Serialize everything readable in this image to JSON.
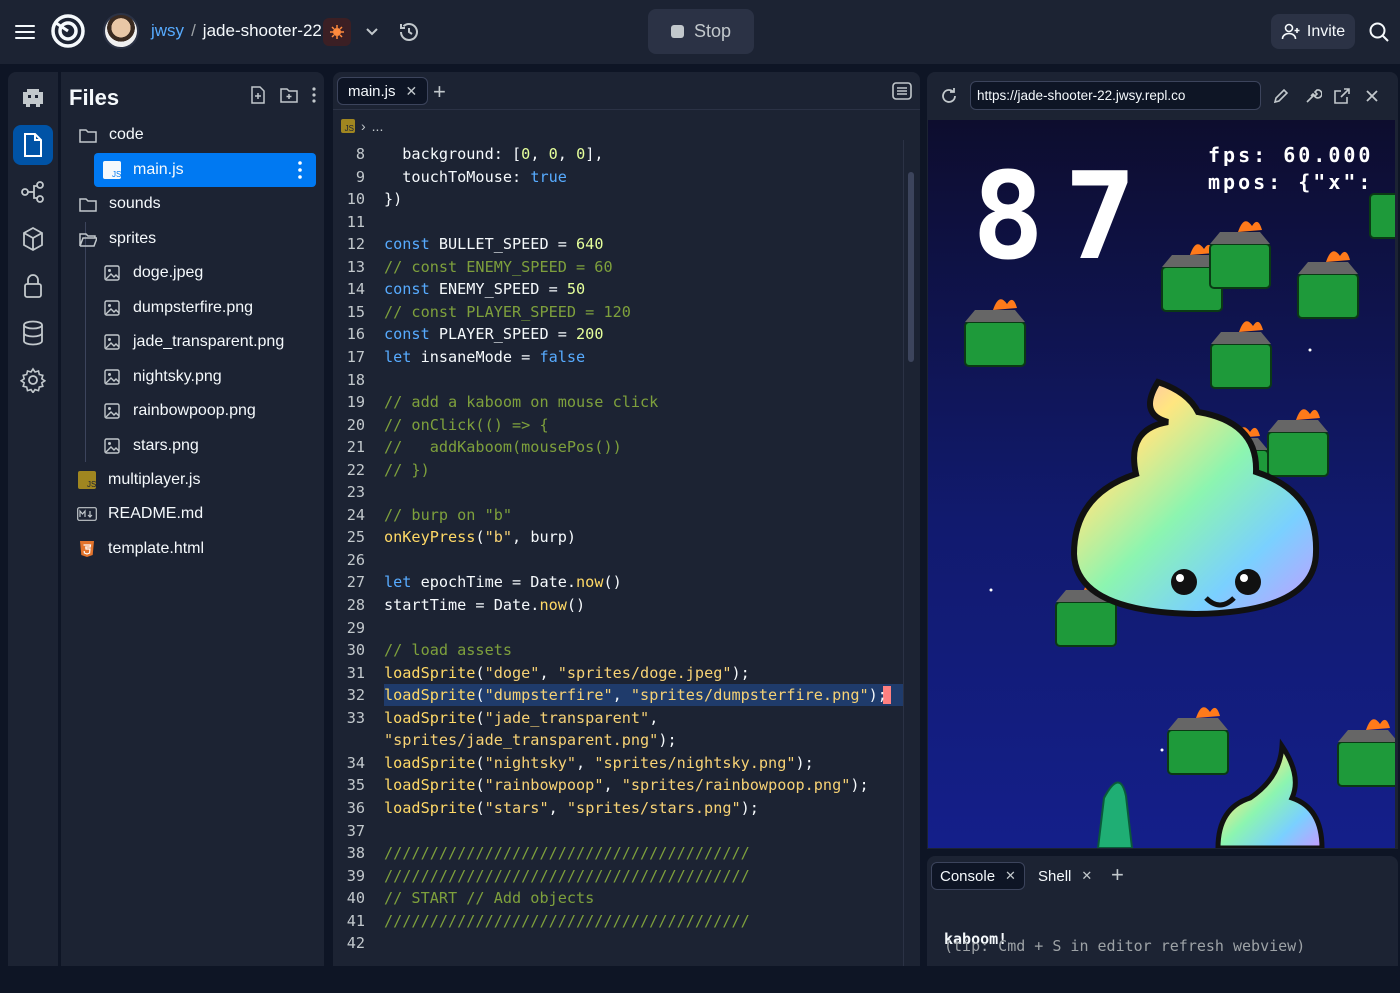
{
  "topbar": {
    "user": "jwsy",
    "separator": "/",
    "project": "jade-shooter-22",
    "stop_label": "Stop",
    "invite_label": "Invite"
  },
  "files": {
    "title": "Files",
    "items": [
      {
        "label": "code",
        "icon": "folder-icon"
      },
      {
        "label": "main.js",
        "icon": "js-file-icon"
      },
      {
        "label": "sounds",
        "icon": "folder-icon"
      },
      {
        "label": "sprites",
        "icon": "folder-open-icon"
      },
      {
        "label": "doge.jpeg",
        "icon": "image-file-icon"
      },
      {
        "label": "dumpsterfire.png",
        "icon": "image-file-icon"
      },
      {
        "label": "jade_transparent.png",
        "icon": "image-file-icon"
      },
      {
        "label": "nightsky.png",
        "icon": "image-file-icon"
      },
      {
        "label": "rainbowpoop.png",
        "icon": "image-file-icon"
      },
      {
        "label": "stars.png",
        "icon": "image-file-icon"
      },
      {
        "label": "multiplayer.js",
        "icon": "js-file-icon"
      },
      {
        "label": "README.md",
        "icon": "markdown-file-icon"
      },
      {
        "label": "template.html",
        "icon": "html-file-icon"
      }
    ]
  },
  "editor": {
    "tab_label": "main.js",
    "path_ellipsis": "...",
    "js_badge": "JS",
    "lines": [
      {
        "n": "8",
        "html": "  background: [<span class=\"num\">0</span>, <span class=\"num\">0</span>, <span class=\"num\">0</span>],"
      },
      {
        "n": "9",
        "html": "  touchToMouse: <span class=\"kw\">true</span>"
      },
      {
        "n": "10",
        "html": "})"
      },
      {
        "n": "11",
        "html": ""
      },
      {
        "n": "12",
        "html": "<span class=\"kw\">const</span> BULLET_SPEED = <span class=\"num\">640</span>"
      },
      {
        "n": "13",
        "html": "<span class=\"cm\">// const ENEMY_SPEED = 60</span>"
      },
      {
        "n": "14",
        "html": "<span class=\"kw\">const</span> ENEMY_SPEED = <span class=\"num\">50</span>"
      },
      {
        "n": "15",
        "html": "<span class=\"cm\">// const PLAYER_SPEED = 120</span>"
      },
      {
        "n": "16",
        "html": "<span class=\"kw\">const</span> PLAYER_SPEED = <span class=\"num\">200</span>"
      },
      {
        "n": "17",
        "html": "<span class=\"kw\">let</span> insaneMode = <span class=\"kw\">false</span>"
      },
      {
        "n": "18",
        "html": ""
      },
      {
        "n": "19",
        "html": "<span class=\"cm\">// add a kaboom on mouse click</span>"
      },
      {
        "n": "20",
        "html": "<span class=\"cm\">// onClick(() =&gt; {</span>"
      },
      {
        "n": "21",
        "html": "<span class=\"cm\">//   addKaboom(mousePos())</span>"
      },
      {
        "n": "22",
        "html": "<span class=\"cm\">// })</span>"
      },
      {
        "n": "23",
        "html": ""
      },
      {
        "n": "24",
        "html": "<span class=\"cm\">// burp on \"b\"</span>"
      },
      {
        "n": "25",
        "html": "<span class=\"fn\">onKeyPress</span>(<span class=\"str\">\"b\"</span>, burp)"
      },
      {
        "n": "26",
        "html": ""
      },
      {
        "n": "27",
        "html": "<span class=\"kw\">let</span> epochTime = Date.<span class=\"fn\">now</span>()"
      },
      {
        "n": "28",
        "html": "startTime = Date.<span class=\"fn\">now</span>()"
      },
      {
        "n": "29",
        "html": ""
      },
      {
        "n": "30",
        "html": "<span class=\"cm\">// load assets</span>"
      },
      {
        "n": "31",
        "html": "<span class=\"fn\">loadSprite</span>(<span class=\"str\">\"doge\"</span>, <span class=\"str\">\"sprites/doge.jpeg\"</span>);"
      },
      {
        "n": "32",
        "html": "<span class=\"fn\">loadSprite</span>(<span class=\"str\">\"dumpsterfire\"</span>, <span class=\"str\">\"sprites/dumpsterfire.png\"</span>);"
      },
      {
        "n": "33",
        "html": "<span class=\"fn\">loadSprite</span>(<span class=\"str\">\"jade_transparent\"</span>,"
      },
      {
        "n": "",
        "html": "<span class=\"str\">\"sprites/jade_transparent.png\"</span>);"
      },
      {
        "n": "34",
        "html": "<span class=\"fn\">loadSprite</span>(<span class=\"str\">\"nightsky\"</span>, <span class=\"str\">\"sprites/nightsky.png\"</span>);"
      },
      {
        "n": "35",
        "html": "<span class=\"fn\">loadSprite</span>(<span class=\"str\">\"rainbowpoop\"</span>, <span class=\"str\">\"sprites/rainbowpoop.png\"</span>);"
      },
      {
        "n": "36",
        "html": "<span class=\"fn\">loadSprite</span>(<span class=\"str\">\"stars\"</span>, <span class=\"str\">\"sprites/stars.png\"</span>);"
      },
      {
        "n": "37",
        "html": ""
      },
      {
        "n": "38",
        "html": "<span class=\"cm\">////////////////////////////////////////</span>"
      },
      {
        "n": "39",
        "html": "<span class=\"cm\">////////////////////////////////////////</span>"
      },
      {
        "n": "40",
        "html": "<span class=\"cm\">// START // Add objects</span>"
      },
      {
        "n": "41",
        "html": "<span class=\"cm\">////////////////////////////////////////</span>"
      },
      {
        "n": "42",
        "html": ""
      }
    ]
  },
  "webview": {
    "url": "https://jade-shooter-22.jwsy.repl.co",
    "score": "87",
    "fps_line": "fps: 60.000",
    "mpos_line": "mpos: {\"x\":"
  },
  "console": {
    "tabs": [
      "Console",
      "Shell"
    ],
    "output": [
      "kaboom!",
      "(tip: Cmd + S in editor refresh webview)"
    ]
  },
  "colors": {
    "bg": "#0e1525",
    "panel": "#1c2333",
    "accent": "#0079f2",
    "link": "#57abff"
  }
}
